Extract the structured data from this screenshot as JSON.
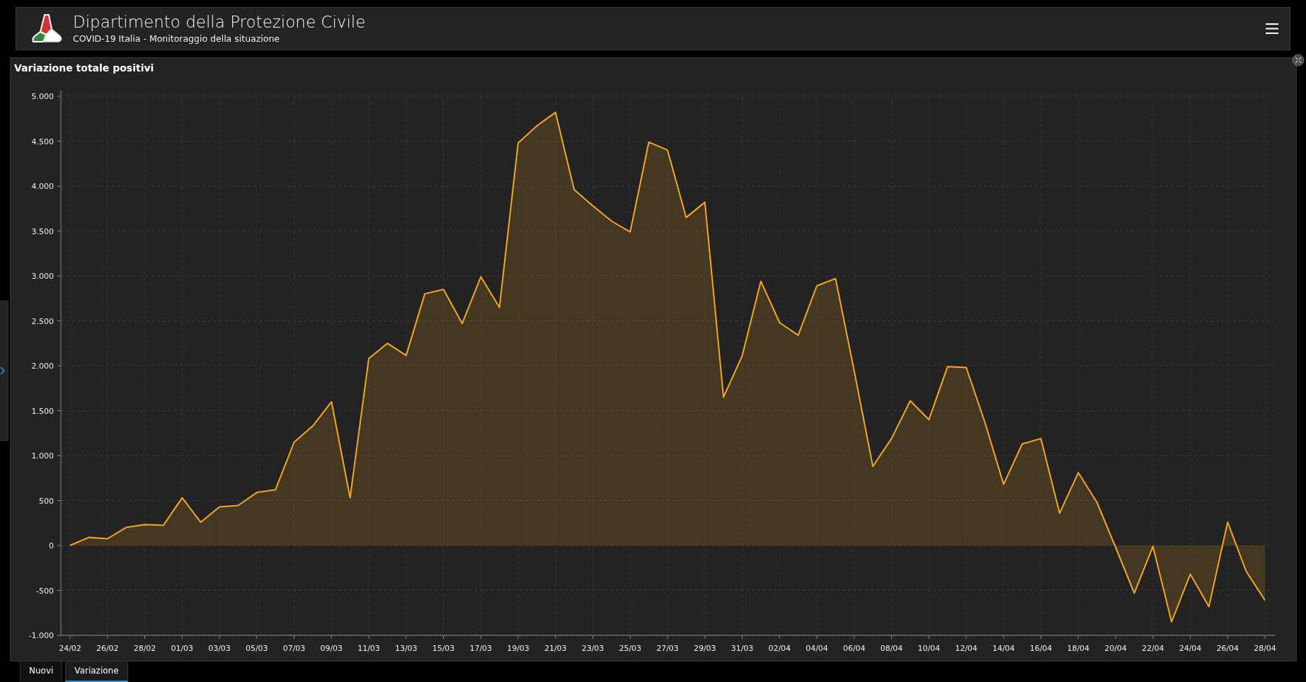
{
  "header": {
    "title": "Dipartimento della Protezione Civile",
    "subtitle": "COVID-19 Italia - Monitoraggio della situazione"
  },
  "panel": {
    "title": "Variazione totale positivi",
    "chart_data": {
      "type": "area",
      "categories": [
        "24/02",
        null,
        "26/02",
        null,
        "28/02",
        null,
        "01/03",
        null,
        "03/03",
        null,
        "05/03",
        null,
        "07/03",
        null,
        "09/03",
        null,
        "11/03",
        null,
        "13/03",
        null,
        "15/03",
        null,
        "17/03",
        null,
        "19/03",
        null,
        "21/03",
        null,
        "23/03",
        null,
        "25/03",
        null,
        "27/03",
        null,
        "29/03",
        null,
        "31/03",
        null,
        "02/04",
        null,
        "04/04",
        null,
        "06/04",
        null,
        "08/04",
        null,
        "10/04",
        null,
        "12/04",
        null,
        "14/04",
        null,
        "16/04",
        null,
        "18/04",
        null,
        "20/04",
        null,
        "22/04",
        null,
        "24/04",
        null,
        "26/04",
        null,
        "28/04"
      ],
      "series": [
        {
          "color": "#f5a623",
          "values": [
            0,
            90,
            75,
            200,
            233,
            225,
            530,
            258,
            430,
            445,
            590,
            620,
            1150,
            1330,
            1600,
            530,
            2080,
            2250,
            2115,
            2800,
            2850,
            2470,
            2990,
            2650,
            4480,
            4670,
            4820,
            3960,
            3780,
            3610,
            3490,
            4490,
            4400,
            3650,
            3820,
            1650,
            2110,
            2940,
            2480,
            2340,
            2890,
            2970,
            1940,
            880,
            1190,
            1610,
            1400,
            1990,
            1980,
            1370,
            680,
            1130,
            1190,
            360,
            810,
            480,
            -20,
            -530,
            -10,
            -850,
            -320,
            -680,
            260,
            -290,
            -610
          ]
        }
      ],
      "ylim": [
        -1000,
        5000
      ],
      "yticks": [
        {
          "value": 5000,
          "label": "5.000"
        },
        {
          "value": 4500,
          "label": "4.500"
        },
        {
          "value": 4000,
          "label": "4.000"
        },
        {
          "value": 3500,
          "label": "3.500"
        },
        {
          "value": 3000,
          "label": "3.000"
        },
        {
          "value": 2500,
          "label": "2.500"
        },
        {
          "value": 2000,
          "label": "2.000"
        },
        {
          "value": 1500,
          "label": "1.500"
        },
        {
          "value": 1000,
          "label": "1.000"
        },
        {
          "value": 500,
          "label": "500"
        },
        {
          "value": 0,
          "label": "0"
        },
        {
          "value": -500,
          "label": "-500"
        },
        {
          "value": -1000,
          "label": "-1.000"
        }
      ],
      "grid": true
    }
  },
  "tabs": [
    {
      "label": "Nuovi",
      "selected": false
    },
    {
      "label": "Variazione",
      "selected": true
    }
  ]
}
